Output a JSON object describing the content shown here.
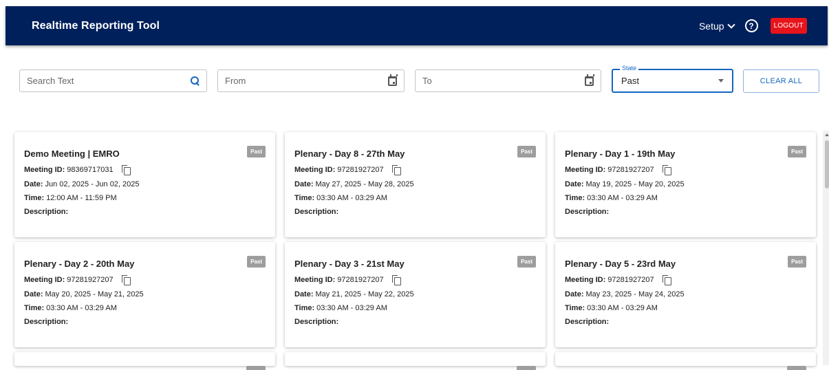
{
  "header": {
    "title": "Realtime Reporting Tool",
    "setup_label": "Setup",
    "help_icon": "help-circle-icon",
    "logout_label": "LOGOUT",
    "brand_color": "#00205b",
    "logout_color": "#e8141b"
  },
  "filters": {
    "search_placeholder": "Search Text",
    "from_placeholder": "From",
    "to_placeholder": "To",
    "state_label": "State",
    "state_value": "Past",
    "clear_label": "CLEAR ALL"
  },
  "labels": {
    "meeting_id": "Meeting ID:",
    "date": "Date:",
    "time": "Time:",
    "description": "Description:"
  },
  "meetings": [
    {
      "title": "Demo Meeting | EMRO",
      "status": "Past",
      "meeting_id": "98369717031",
      "date": "Jun 02, 2025 - Jun 02, 2025",
      "time": "12:00 AM - 11:59 PM",
      "description": ""
    },
    {
      "title": "Plenary - Day 8 - 27th May",
      "status": "Past",
      "meeting_id": "97281927207",
      "date": "May 27, 2025 - May 28, 2025",
      "time": "03:30 AM - 03:29 AM",
      "description": ""
    },
    {
      "title": "Plenary - Day 1 - 19th May",
      "status": "Past",
      "meeting_id": "97281927207",
      "date": "May 19, 2025 - May 20, 2025",
      "time": "03:30 AM - 03:29 AM",
      "description": ""
    },
    {
      "title": "Plenary - Day 2 - 20th May",
      "status": "Past",
      "meeting_id": "97281927207",
      "date": "May 20, 2025 - May 21, 2025",
      "time": "03:30 AM - 03:29 AM",
      "description": ""
    },
    {
      "title": "Plenary - Day 3 - 21st May",
      "status": "Past",
      "meeting_id": "97281927207",
      "date": "May 21, 2025 - May 22, 2025",
      "time": "03:30 AM - 03:29 AM",
      "description": ""
    },
    {
      "title": "Plenary - Day 5 - 23rd May",
      "status": "Past",
      "meeting_id": "97281927207",
      "date": "May 23, 2025 - May 24, 2025",
      "time": "03:30 AM - 03:29 AM",
      "description": ""
    }
  ]
}
